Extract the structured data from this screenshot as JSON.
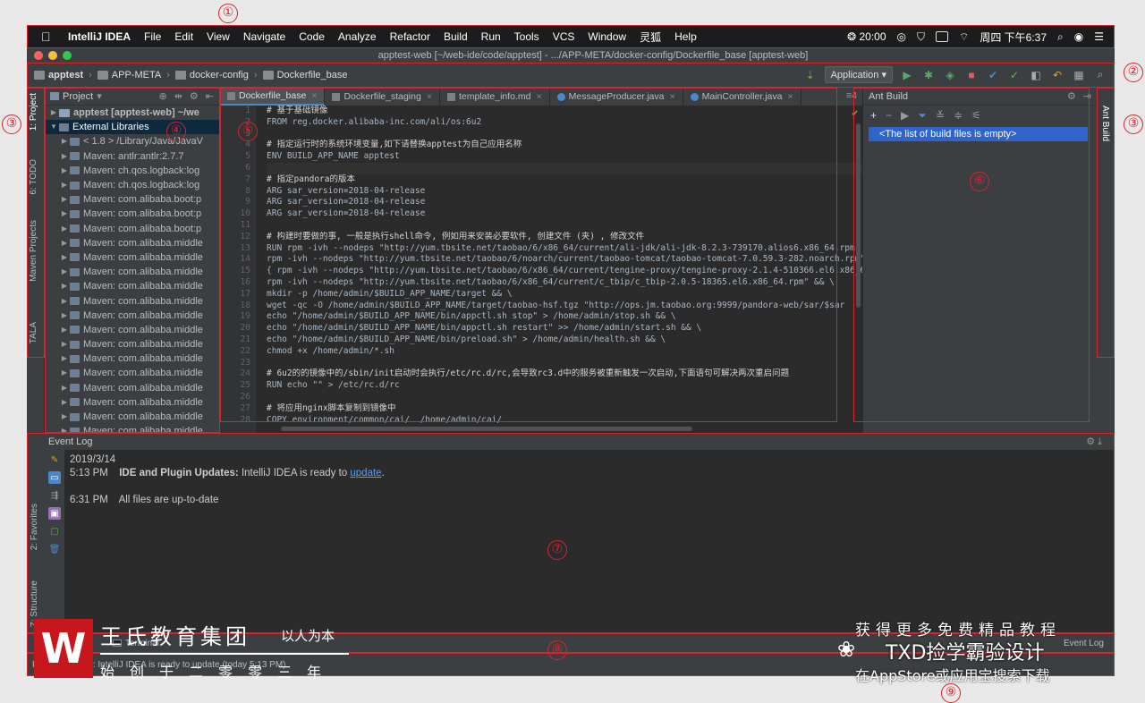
{
  "annotations": [
    "①",
    "②",
    "③",
    "③",
    "④",
    "⑤",
    "⑥",
    "⑦",
    "⑧",
    "⑨"
  ],
  "menubar": {
    "apple": "",
    "items": [
      "IntelliJ IDEA",
      "File",
      "Edit",
      "View",
      "Navigate",
      "Code",
      "Analyze",
      "Refactor",
      "Build",
      "Run",
      "Tools",
      "VCS",
      "Window",
      "灵狐",
      "Help"
    ],
    "time_badge": "20:00",
    "clock": "周四 下午6:37"
  },
  "window": {
    "title": "apptest-web [~/web-ide/code/apptest] - .../APP-META/docker-config/Dockerfile_base [apptest-web]",
    "close_color": "#fc615d",
    "min_color": "#fdbc40",
    "max_color": "#34c84a"
  },
  "breadcrumbs": [
    "apptest",
    "APP-META",
    "docker-config",
    "Dockerfile_base"
  ],
  "run_config": "Application",
  "left_stripe": [
    "1: Project",
    "6: TODO",
    "Maven Projects",
    "TALA"
  ],
  "right_stripe": [
    "Ant Build"
  ],
  "project": {
    "title": "Project",
    "rows": [
      {
        "label": "apptest [apptest-web]  ~/we",
        "arrow": "▶",
        "indent": 0,
        "icon": "folder"
      },
      {
        "label": "External Libraries",
        "arrow": "▼",
        "indent": 0,
        "icon": "lib",
        "selected": true
      },
      {
        "label": "< 1.8 >  /Library/Java/JavaV",
        "arrow": "▶",
        "indent": 1,
        "icon": "lib"
      },
      {
        "label": "Maven: antlr:antlr:2.7.7",
        "arrow": "▶",
        "indent": 1,
        "icon": "lib"
      },
      {
        "label": "Maven: ch.qos.logback:log",
        "arrow": "▶",
        "indent": 1,
        "icon": "lib"
      },
      {
        "label": "Maven: ch.qos.logback:log",
        "arrow": "▶",
        "indent": 1,
        "icon": "lib"
      },
      {
        "label": "Maven: com.alibaba.boot:p",
        "arrow": "▶",
        "indent": 1,
        "icon": "lib"
      },
      {
        "label": "Maven: com.alibaba.boot:p",
        "arrow": "▶",
        "indent": 1,
        "icon": "lib"
      },
      {
        "label": "Maven: com.alibaba.boot:p",
        "arrow": "▶",
        "indent": 1,
        "icon": "lib"
      },
      {
        "label": "Maven: com.alibaba.middle",
        "arrow": "▶",
        "indent": 1,
        "icon": "lib"
      },
      {
        "label": "Maven: com.alibaba.middle",
        "arrow": "▶",
        "indent": 1,
        "icon": "lib"
      },
      {
        "label": "Maven: com.alibaba.middle",
        "arrow": "▶",
        "indent": 1,
        "icon": "lib"
      },
      {
        "label": "Maven: com.alibaba.middle",
        "arrow": "▶",
        "indent": 1,
        "icon": "lib"
      },
      {
        "label": "Maven: com.alibaba.middle",
        "arrow": "▶",
        "indent": 1,
        "icon": "lib"
      },
      {
        "label": "Maven: com.alibaba.middle",
        "arrow": "▶",
        "indent": 1,
        "icon": "lib"
      },
      {
        "label": "Maven: com.alibaba.middle",
        "arrow": "▶",
        "indent": 1,
        "icon": "lib"
      },
      {
        "label": "Maven: com.alibaba.middle",
        "arrow": "▶",
        "indent": 1,
        "icon": "lib"
      },
      {
        "label": "Maven: com.alibaba.middle",
        "arrow": "▶",
        "indent": 1,
        "icon": "lib"
      },
      {
        "label": "Maven: com.alibaba.middle",
        "arrow": "▶",
        "indent": 1,
        "icon": "lib"
      },
      {
        "label": "Maven: com.alibaba.middle",
        "arrow": "▶",
        "indent": 1,
        "icon": "lib"
      },
      {
        "label": "Maven: com.alibaba.middle",
        "arrow": "▶",
        "indent": 1,
        "icon": "lib"
      },
      {
        "label": "Maven: com.alibaba.middle",
        "arrow": "▶",
        "indent": 1,
        "icon": "lib"
      },
      {
        "label": "Maven: com.alibaba.middle",
        "arrow": "▶",
        "indent": 1,
        "icon": "lib"
      }
    ]
  },
  "editor": {
    "tabs": [
      {
        "label": "Dockerfile_base",
        "active": true,
        "kind": "file"
      },
      {
        "label": "Dockerfile_staging",
        "active": false,
        "kind": "file"
      },
      {
        "label": "template_info.md",
        "active": false,
        "kind": "file"
      },
      {
        "label": "MessageProducer.java",
        "active": false,
        "kind": "java"
      },
      {
        "label": "MainController.java",
        "active": false,
        "kind": "java"
      }
    ],
    "lines": [
      "# 基于基础镜像",
      "FROM reg.docker.alibaba-inc.com/ali/os:6u2",
      "",
      "# 指定运行时的系统环境变量,如下请替换apptest为自己应用名称",
      "ENV BUILD_APP_NAME apptest",
      "",
      "# 指定pandora的版本",
      "ARG sar_version=2018-04-release",
      "ARG sar_version=2018-04-release",
      "ARG sar_version=2018-04-release",
      "",
      "# 构建时要做的事, 一般是执行shell命令, 例如用来安装必要软件, 创建文件 (夹) , 修改文件",
      "RUN rpm -ivh --nodeps \"http://yum.tbsite.net/taobao/6/x86_64/current/ali-jdk/ali-jdk-8.2.3-739170.alios6.x86_64.rpm\"",
      "rpm -ivh --nodeps \"http://yum.tbsite.net/taobao/6/noarch/current/taobao-tomcat/taobao-tomcat-7.0.59.3-282.noarch.rpm\"",
      "{ rpm -ivh --nodeps \"http://yum.tbsite.net/taobao/6/x86_64/current/tengine-proxy/tengine-proxy-2.1.4-510366.el6.x86_64.rpm\"",
      "rpm -ivh --nodeps \"http://yum.tbsite.net/taobao/6/x86_64/current/c_tbip/c_tbip-2.0.5-18365.el6.x86_64.rpm\" && \\",
      "mkdir -p /home/admin/$BUILD_APP_NAME/target && \\",
      "wget -qc -O /home/admin/$BUILD_APP_NAME/target/taobao-hsf.tgz \"http://ops.jm.taobao.org:9999/pandora-web/sar/$sar",
      "echo \"/home/admin/$BUILD_APP_NAME/bin/appctl.sh stop\" > /home/admin/stop.sh && \\",
      "echo \"/home/admin/$BUILD_APP_NAME/bin/appctl.sh restart\" >> /home/admin/start.sh && \\",
      "echo \"/home/admin/$BUILD_APP_NAME/bin/preload.sh\" > /home/admin/health.sh && \\",
      "chmod +x /home/admin/*.sh",
      "",
      "# 6u2的的镜像中的/sbin/init启动时会执行/etc/rc.d/rc,会导致rc3.d中的服务被重新触发一次启动,下面语句可解决两次重启问题",
      "RUN echo \"\" > /etc/rc.d/rc",
      "",
      "# 将应用nginx脚本复制到镜像中",
      "COPY environment/common/cai/  /home/admin/cai/"
    ]
  },
  "ant_build": {
    "title": "Ant Build",
    "toolbar": [
      "+",
      "−",
      "▶",
      "⏷",
      "≚",
      "≑",
      "⚟"
    ],
    "message": "<The list of build files is empty>"
  },
  "event_log": {
    "title": "Event Log",
    "entries": [
      {
        "time": "2019/3/14",
        "strong": "",
        "text": "",
        "link": ""
      },
      {
        "time": "5:13 PM",
        "strong": "IDE and Plugin Updates:",
        "text": " IntelliJ IDEA is ready to ",
        "link": "update",
        "tail": "."
      },
      {
        "time": "",
        "strong": "",
        "text": "",
        "link": ""
      },
      {
        "time": "6:31 PM",
        "strong": "",
        "text": "All files are up-to-date",
        "link": ""
      }
    ],
    "side_tabs": [
      "2: Favorites",
      "Z: Structure"
    ]
  },
  "bottom_strip": {
    "terminal": "Terminal",
    "event_log_tab": "Event Log"
  },
  "status": {
    "text": "Plugin Updates: IntelliJ IDEA is ready to update (today 5:13 PM)"
  },
  "watermark": {
    "logo_letter": "W",
    "org": "王氏教育集团",
    "motto": "以人为本",
    "sub": "始创于二零零三年",
    "promo_line1": "获得更多免费精品教程",
    "promo_line2": "TXD捡学霸验设计",
    "promo_line3": "在AppStore或应用宝搜索下载"
  },
  "colors": {
    "annotation": "#d9232d",
    "accent": "#4a88c7",
    "selection": "#2f65ca"
  }
}
